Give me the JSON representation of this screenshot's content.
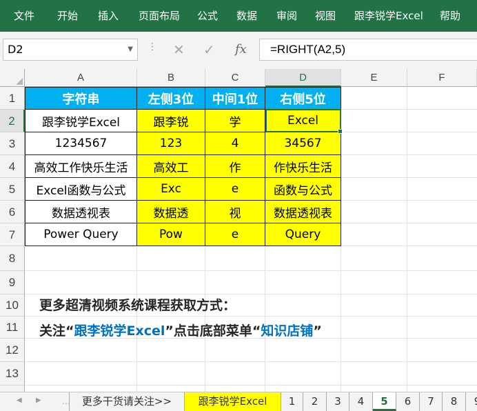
{
  "ribbon": {
    "tabs": [
      "文件",
      "开始",
      "插入",
      "页面布局",
      "公式",
      "数据",
      "审阅",
      "视图",
      "跟李锐学Excel",
      "帮助"
    ]
  },
  "formula_bar": {
    "name_box": "D2",
    "formula": "=RIGHT(A2,5)",
    "cancel_icon": "✕",
    "enter_icon": "✓",
    "fx_icon": "fx"
  },
  "columns": [
    "A",
    "B",
    "C",
    "D",
    "E",
    "F"
  ],
  "rows": [
    "1",
    "2",
    "3",
    "4",
    "5",
    "6",
    "7",
    "8",
    "9",
    "10",
    "11",
    "12",
    "13"
  ],
  "table": {
    "headers": [
      "字符串",
      "左侧3位",
      "中间1位",
      "右侧5位"
    ],
    "data": [
      [
        "跟李锐学Excel",
        "跟李锐",
        "学",
        "Excel"
      ],
      [
        "1234567",
        "123",
        "4",
        "34567"
      ],
      [
        "高效工作快乐生活",
        "高效工",
        "作",
        "作快乐生活"
      ],
      [
        "Excel函数与公式",
        "Exc",
        "e",
        "函数与公式"
      ],
      [
        "数据透视表",
        "数据透",
        "视",
        "数据透视表"
      ],
      [
        "Power Query",
        "Pow",
        "e",
        "Query"
      ]
    ]
  },
  "promo": {
    "line1": "更多超清视频系统课程获取方式：",
    "line2_part1": "关注“",
    "line2_hl1": "跟李锐学Excel",
    "line2_part2": "”点击底部菜单“",
    "line2_hl2": "知识店铺",
    "line2_part3": "”"
  },
  "sheet_tabs": [
    "更多干货请关注>>",
    "跟李锐学Excel",
    "1",
    "2",
    "3",
    "4",
    "5",
    "6",
    "7",
    "8",
    "9"
  ],
  "active_sheet": "5",
  "colors": {
    "ribbon": "#217346",
    "header_fill": "#00b0f0",
    "value_fill": "#ffff00",
    "promo_highlight": "#0070c0"
  }
}
